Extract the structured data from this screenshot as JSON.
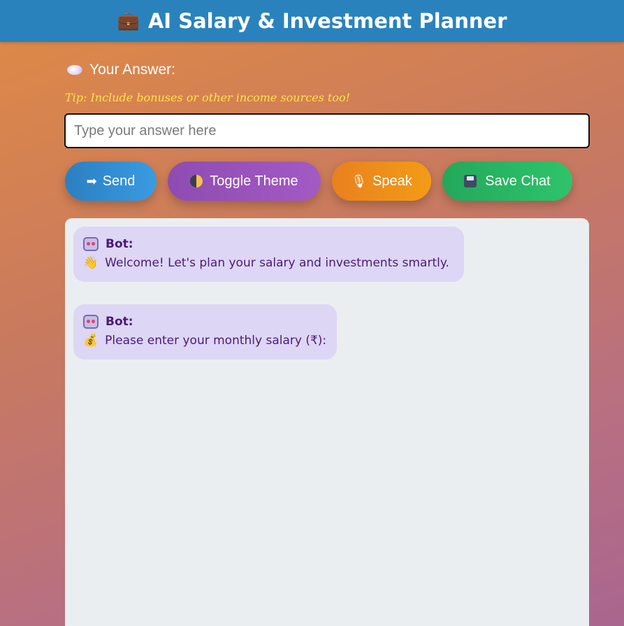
{
  "header": {
    "icon": "briefcase-icon",
    "title": "AI Salary & Investment Planner"
  },
  "answer": {
    "label": "Your Answer:",
    "tip": "Tip: Include bonuses or other income sources too!",
    "placeholder": "Type your answer here",
    "value": ""
  },
  "buttons": {
    "send": "Send",
    "toggle_theme": "Toggle Theme",
    "speak": "Speak",
    "save_chat": "Save Chat"
  },
  "chat": {
    "messages": [
      {
        "sender": "Bot:",
        "text": "Welcome! Let's plan your salary and investments smartly.",
        "icon": "waving-hand-icon"
      },
      {
        "sender": "Bot:",
        "text": "Please enter your monthly salary (₹):",
        "icon": "money-bag-icon"
      }
    ]
  },
  "colors": {
    "header_bg": "#2a82bd",
    "tip": "#ffe44a",
    "send": "#2b7fc2",
    "toggle_theme": "#8e4cb2",
    "speak": "#e9801f",
    "save_chat": "#24a85b",
    "bubble_bg": "#ddd6f5",
    "bubble_text": "#4b1a78"
  }
}
